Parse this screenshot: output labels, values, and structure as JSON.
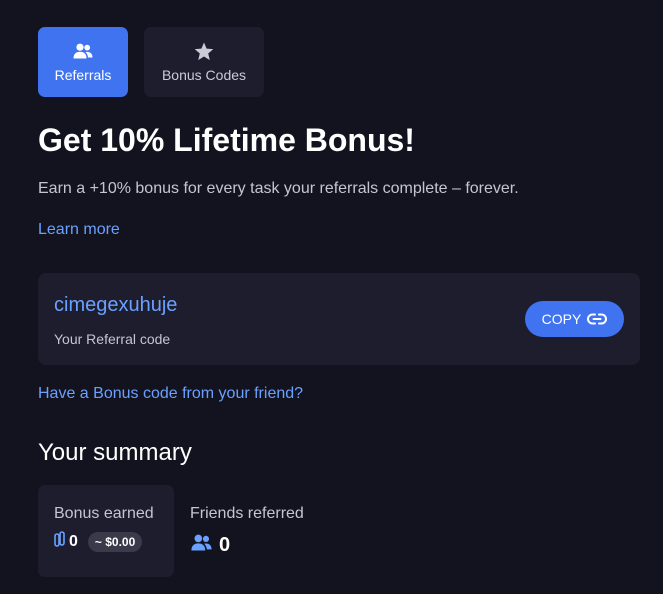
{
  "tabs": [
    {
      "label": "Referrals",
      "icon": "users-icon",
      "active": true
    },
    {
      "label": "Bonus Codes",
      "icon": "star-icon",
      "active": false
    }
  ],
  "header": {
    "title": "Get 10% Lifetime Bonus!",
    "subtitle": "Earn a +10% bonus for every task your referrals complete – forever.",
    "learn_more": "Learn more"
  },
  "referral": {
    "code": "cimegexuhuje",
    "caption": "Your Referral code",
    "copy_label": "COPY",
    "copy_icon": "link-icon"
  },
  "bonus_link": "Have a Bonus code from your friend?",
  "summary": {
    "heading": "Your summary",
    "bonus_earned": {
      "label": "Bonus earned",
      "icon": "coin-icon",
      "value": "0",
      "usd": "~ $0.00"
    },
    "friends_referred": {
      "label": "Friends referred",
      "icon": "users-icon",
      "value": "0"
    }
  },
  "colors": {
    "background": "#13131f",
    "card": "#1d1d2e",
    "accent": "#3f73f0",
    "link": "#6aa0ff",
    "muted_text": "#c3c6d0"
  }
}
